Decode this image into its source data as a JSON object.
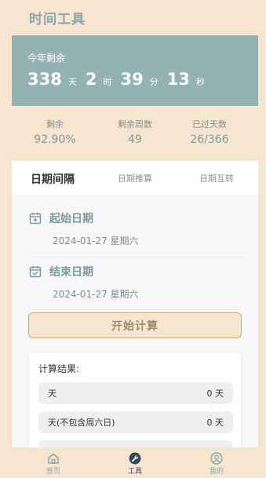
{
  "header": {
    "title": "时间工具"
  },
  "countdown": {
    "label": "今年剩余",
    "days": "338",
    "days_unit": "天",
    "hours": "2",
    "hours_unit": "时",
    "minutes": "39",
    "minutes_unit": "分",
    "seconds": "13",
    "seconds_unit": "秒"
  },
  "stats": [
    {
      "label": "剩余",
      "value": "92.90%"
    },
    {
      "label": "剩余周数",
      "value": "49"
    },
    {
      "label": "已过天数",
      "value": "26/366"
    }
  ],
  "tabs": [
    {
      "label": "日期间隔",
      "active": true
    },
    {
      "label": "日期推算",
      "active": false
    },
    {
      "label": "日期互转",
      "active": false
    }
  ],
  "start_date": {
    "title": "起始日期",
    "value": "2024-01-27 星期六"
  },
  "end_date": {
    "title": "结束日期",
    "value": "2024-01-27 星期六"
  },
  "calculate_button": "开始计算",
  "result": {
    "title": "计算结果:",
    "rows": [
      {
        "label": "天",
        "value": "0 天"
      },
      {
        "label": "天(不包含周六日)",
        "value": "0 天"
      }
    ]
  },
  "bottom_nav": [
    {
      "label": "首页",
      "icon": "home-icon",
      "active": false
    },
    {
      "label": "工具",
      "icon": "wrench-icon",
      "active": true
    },
    {
      "label": "我的",
      "icon": "user-icon",
      "active": false
    }
  ],
  "colors": {
    "background": "#f6e6d0",
    "accent": "#93b2b3",
    "button_border": "#c9a882"
  }
}
